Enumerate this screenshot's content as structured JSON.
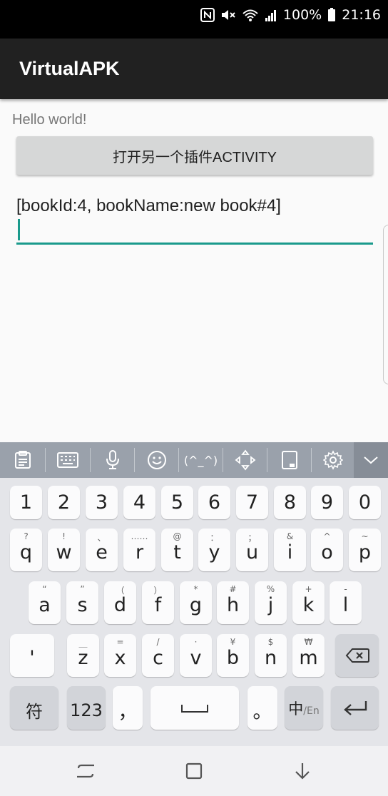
{
  "status_bar": {
    "battery": "100%",
    "time": "21:16",
    "icons": [
      "nfc-icon",
      "mute-icon",
      "wifi-icon",
      "signal-icon",
      "battery-icon"
    ]
  },
  "app_bar": {
    "title": "VirtualAPK"
  },
  "content": {
    "hello_text": "Hello world!",
    "open_button_label": "打开另一个插件ACTIVITY",
    "book_text": "[bookId:4, bookName:new book#4]",
    "input_value": ""
  },
  "keyboard": {
    "toolbar_icons": [
      "clipboard-icon",
      "keyboard-icon",
      "microphone-icon",
      "emoji-icon",
      "kaomoji-icon",
      "cursor-move-icon",
      "one-hand-icon",
      "settings-icon",
      "collapse-icon"
    ],
    "kaomoji_label": "(^_^)",
    "row_numbers": [
      "1",
      "2",
      "3",
      "4",
      "5",
      "6",
      "7",
      "8",
      "9",
      "0"
    ],
    "row_q": [
      {
        "main": "q",
        "hint": "?"
      },
      {
        "main": "w",
        "hint": "!"
      },
      {
        "main": "e",
        "hint": "、"
      },
      {
        "main": "r",
        "hint": "……"
      },
      {
        "main": "t",
        "hint": "@"
      },
      {
        "main": "y",
        "hint": "："
      },
      {
        "main": "u",
        "hint": "；"
      },
      {
        "main": "i",
        "hint": "&"
      },
      {
        "main": "o",
        "hint": "^"
      },
      {
        "main": "p",
        "hint": "~"
      }
    ],
    "row_a": [
      {
        "main": "a",
        "hint": "“"
      },
      {
        "main": "s",
        "hint": "”"
      },
      {
        "main": "d",
        "hint": "（"
      },
      {
        "main": "f",
        "hint": "）"
      },
      {
        "main": "g",
        "hint": "*"
      },
      {
        "main": "h",
        "hint": "#"
      },
      {
        "main": "j",
        "hint": "%"
      },
      {
        "main": "k",
        "hint": "+"
      },
      {
        "main": "l",
        "hint": "-"
      }
    ],
    "row_z": [
      {
        "main": "z",
        "hint": "＿"
      },
      {
        "main": "x",
        "hint": "="
      },
      {
        "main": "c",
        "hint": "/"
      },
      {
        "main": "v",
        "hint": "·"
      },
      {
        "main": "b",
        "hint": "¥"
      },
      {
        "main": "n",
        "hint": "$"
      },
      {
        "main": "m",
        "hint": "₩"
      }
    ],
    "apostrophe_key": "'",
    "symbols_key": "符",
    "numbers_key": "123",
    "comma_key": "，",
    "period_key": "。",
    "lang_key_main": "中",
    "lang_key_sub": "/En"
  },
  "nav_bar": {
    "icons": [
      "recents-icon",
      "home-icon",
      "back-icon"
    ]
  },
  "colors": {
    "accent": "#1a9a8c",
    "app_bar": "#212121",
    "keyboard_toolbar": "#9aa1ab",
    "keyboard_bg": "#e4e5e9"
  }
}
